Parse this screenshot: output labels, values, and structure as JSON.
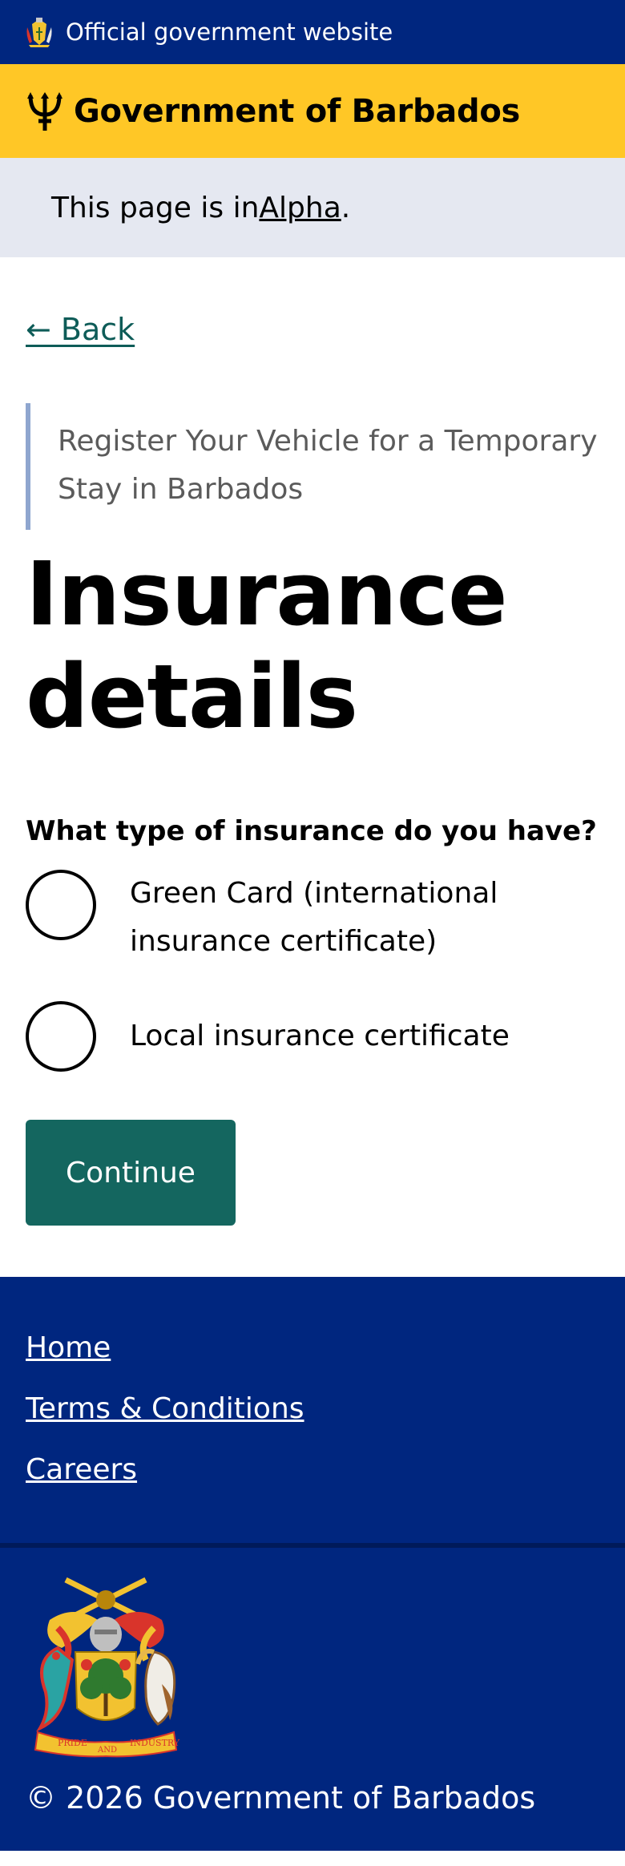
{
  "official_banner": {
    "text": "Official government website"
  },
  "header": {
    "title": "Government of Barbados"
  },
  "phase_banner": {
    "prefix": "This page is in ",
    "link": "Alpha",
    "suffix": "."
  },
  "back_link": "← Back",
  "caption": "Register Your Vehicle for a Temporary Stay in Barbados",
  "page_title": "Insurance details",
  "form": {
    "question": "What type of insurance do you have?",
    "options": [
      {
        "label": "Green Card (international insurance certificate)"
      },
      {
        "label": "Local insurance certificate"
      }
    ],
    "continue_label": "Continue"
  },
  "footer": {
    "links": [
      {
        "label": "Home"
      },
      {
        "label": "Terms & Conditions"
      },
      {
        "label": "Careers"
      }
    ],
    "copyright": "© 2026 Government of Barbados",
    "crest_motto": [
      "PRIDE",
      "AND",
      "INDUSTRY"
    ]
  },
  "colors": {
    "navy": "#00267f",
    "gold": "#ffc726",
    "teal": "#14665f",
    "link_teal": "#0e5c58",
    "phase_bg": "#e5e8f1"
  }
}
